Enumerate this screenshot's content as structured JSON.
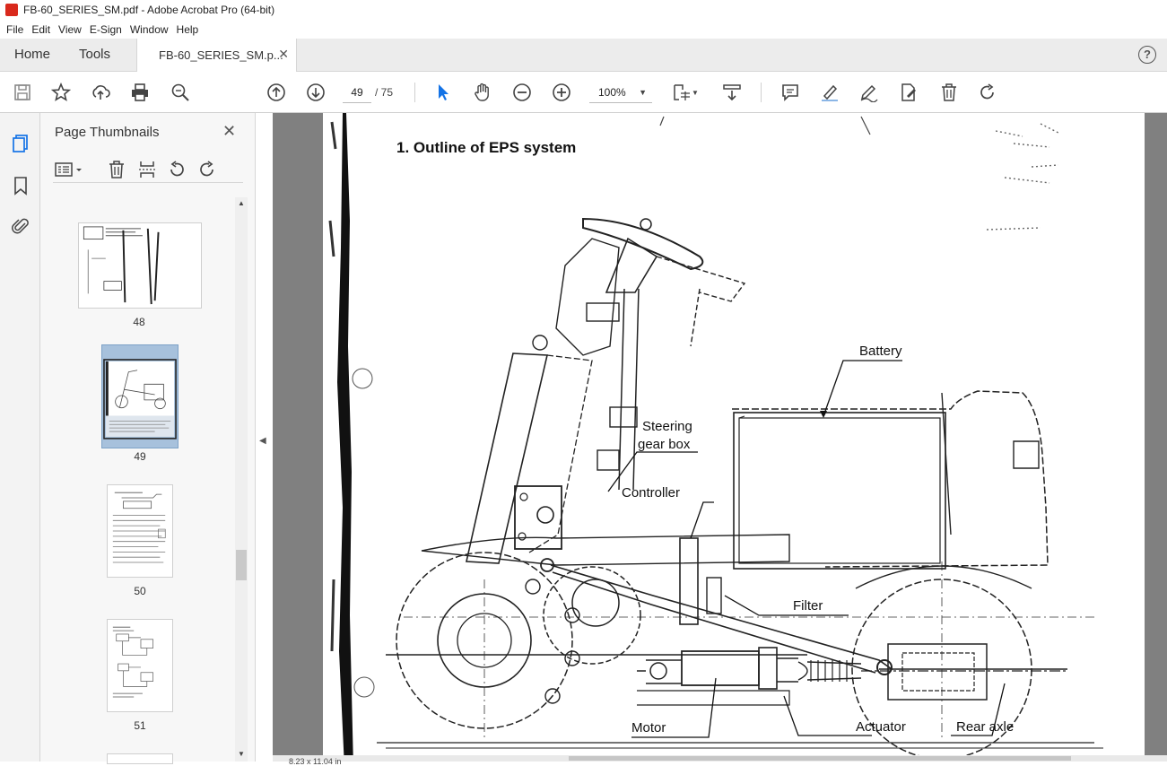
{
  "window": {
    "title": "FB-60_SERIES_SM.pdf - Adobe Acrobat Pro (64-bit)"
  },
  "menu": [
    "File",
    "Edit",
    "View",
    "E-Sign",
    "Window",
    "Help"
  ],
  "tabs": {
    "home": "Home",
    "tools": "Tools",
    "document": "FB-60_SERIES_SM.p...",
    "help": "?"
  },
  "nav": {
    "current_page": "49",
    "total_pages": "/ 75",
    "zoom": "100%"
  },
  "panel": {
    "title": "Page Thumbnails",
    "thumbnails": [
      {
        "page": "48"
      },
      {
        "page": "49",
        "selected": true
      },
      {
        "page": "50"
      },
      {
        "page": "51"
      }
    ]
  },
  "document": {
    "heading": "1.  Outline  of  EPS  system",
    "labels": {
      "battery": "Battery",
      "steering_line1": "Steering",
      "steering_line2": "gear box",
      "controller": "Controller",
      "filter": "Filter",
      "motor": "Motor",
      "actuator": "Actuator",
      "rear_axle": "Rear axle"
    }
  },
  "status": {
    "size_text": "8.23 x 11.04 in"
  },
  "colors": {
    "accent": "#1473e6",
    "selected_thumb": "#a7c1dc",
    "doc_bg": "#808080"
  },
  "icons": [
    "save-icon",
    "star-icon",
    "upload-icon",
    "print-icon",
    "zoom-search-icon",
    "page-up-icon",
    "page-down-icon",
    "select-arrow-icon",
    "hand-icon",
    "zoom-out-icon",
    "zoom-in-icon",
    "fit-page-icon",
    "scroll-mode-icon",
    "comment-icon",
    "highlight-icon",
    "sign-icon",
    "edit-icon",
    "delete-icon",
    "redo-icon"
  ]
}
